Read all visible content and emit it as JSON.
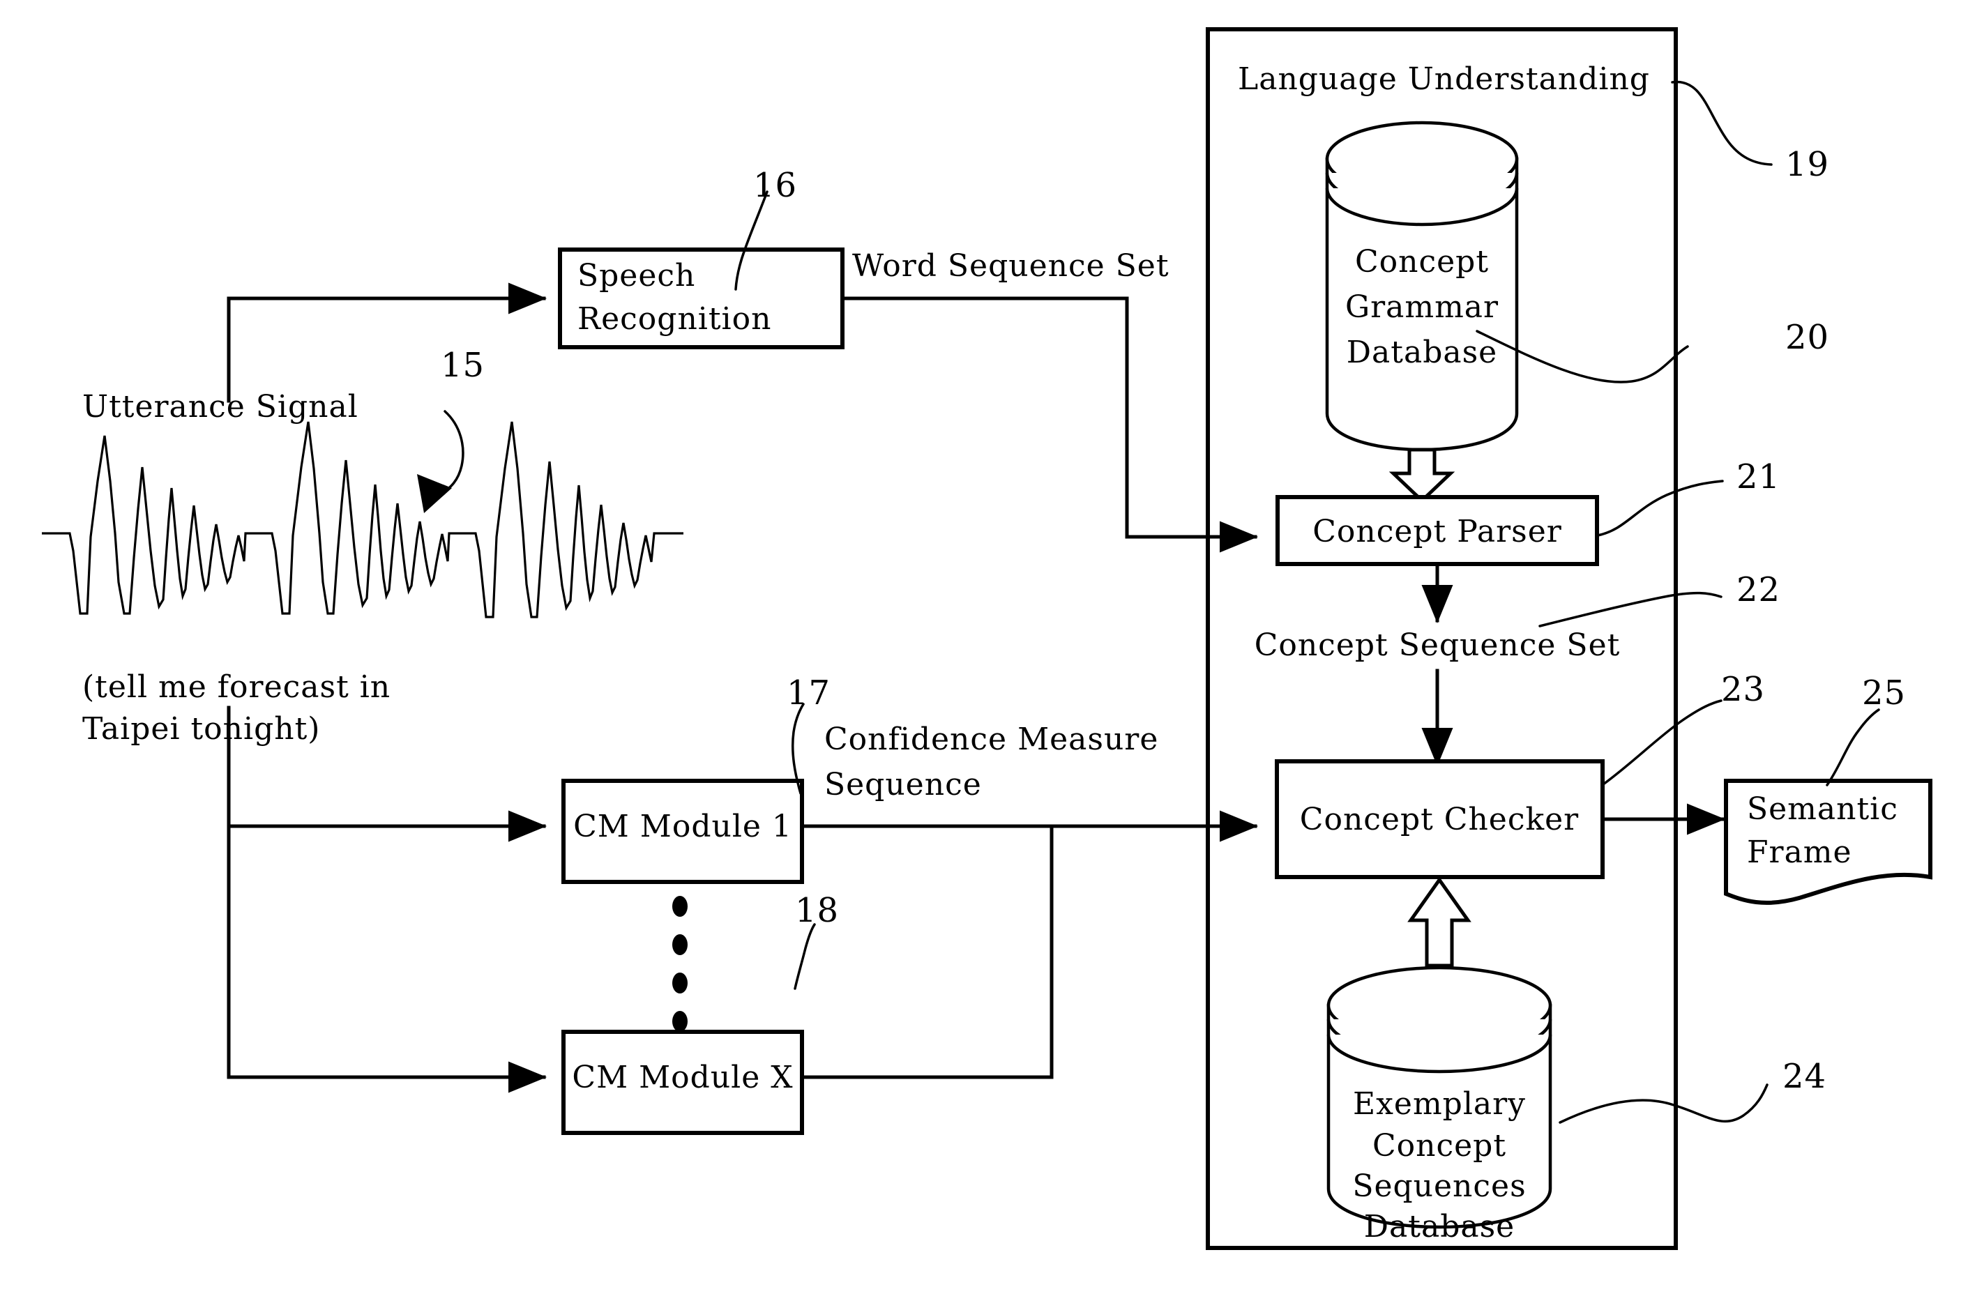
{
  "figure": {
    "title_block": "Language Understanding",
    "utterance": {
      "label": "Utterance Signal",
      "transcript_line1": "(tell me forecast in",
      "transcript_line2": "Taipei tonight)",
      "ref": "15"
    },
    "blocks": {
      "speech_recognition": {
        "line1": "Speech",
        "line2": "Recognition",
        "ref": "16"
      },
      "cm_module_1": {
        "label": "CM Module 1",
        "ref": "17"
      },
      "cm_module_x": {
        "label": "CM Module X",
        "ref": "18"
      },
      "concept_grammar_db": {
        "line1": "Concept",
        "line2": "Grammar",
        "line3": "Database",
        "ref": "20"
      },
      "concept_parser": {
        "label": "Concept Parser",
        "ref": "21"
      },
      "concept_checker": {
        "label": "Concept Checker",
        "ref": "23"
      },
      "exemplary_db": {
        "line1": "Exemplary",
        "line2": "Concept",
        "line3": "Sequences",
        "line4": "Database",
        "ref": "24"
      },
      "semantic_frame": {
        "line1": "Semantic",
        "line2": "Frame",
        "ref": "25"
      },
      "language_understanding": {
        "label": "Language Understanding",
        "ref": "19"
      }
    },
    "edge_labels": {
      "word_sequence_set": "Word Sequence Set",
      "confidence_measure_line1": "Confidence Measure",
      "confidence_measure_line2": "Sequence",
      "concept_sequence_set": "Concept Sequence Set"
    },
    "reference_numbers": [
      "15",
      "16",
      "17",
      "18",
      "19",
      "20",
      "21",
      "22",
      "23",
      "24",
      "25"
    ],
    "colors": {
      "ink": "#000000",
      "paper": "#ffffff"
    }
  }
}
